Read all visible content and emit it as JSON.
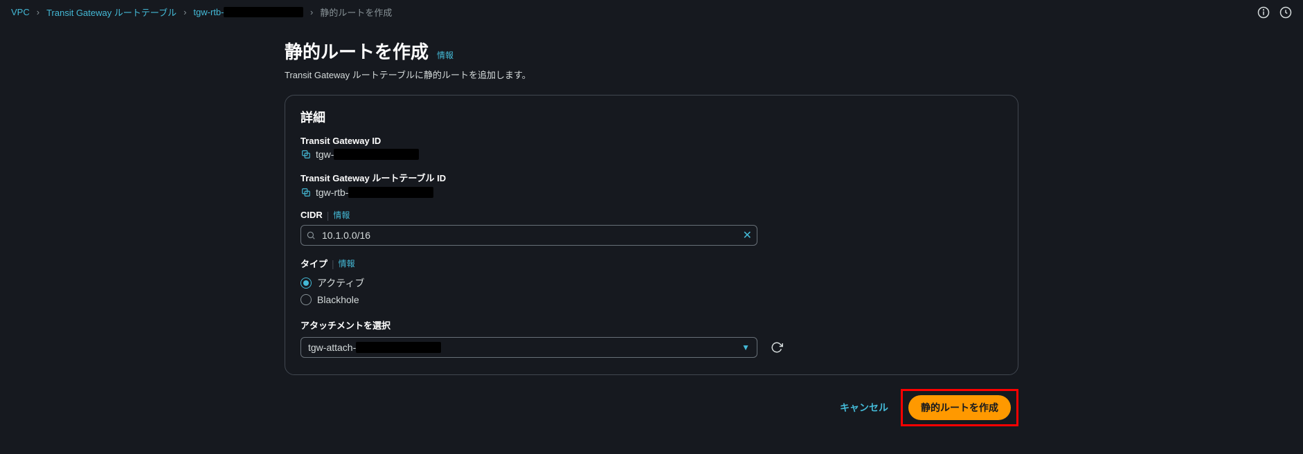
{
  "breadcrumb": {
    "vpc": "VPC",
    "route_tables": "Transit Gateway ルートテーブル",
    "rtb_prefix": "tgw-rtb-",
    "current": "静的ルートを作成"
  },
  "page": {
    "title": "静的ルートを作成",
    "info": "情報",
    "subtitle": "Transit Gateway ルートテーブルに静的ルートを追加します。"
  },
  "details": {
    "heading": "詳細",
    "tgw_id_label": "Transit Gateway ID",
    "tgw_id_prefix": "tgw-",
    "rtb_id_label": "Transit Gateway ルートテーブル ID",
    "rtb_id_prefix": "tgw-rtb-",
    "cidr_label": "CIDR",
    "cidr_info": "情報",
    "cidr_value": "10.1.0.0/16",
    "type_label": "タイプ",
    "type_info": "情報",
    "type_options": {
      "active": "アクティブ",
      "blackhole": "Blackhole"
    },
    "type_selected": "active",
    "attachment_label": "アタッチメントを選択",
    "attachment_value_prefix": "tgw-attach-"
  },
  "actions": {
    "cancel": "キャンセル",
    "submit": "静的ルートを作成"
  }
}
